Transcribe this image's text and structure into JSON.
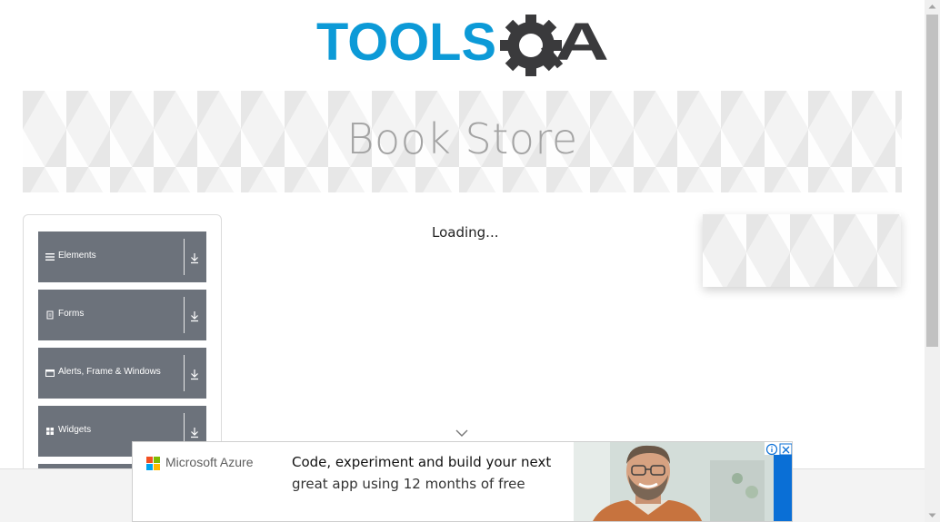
{
  "logo": {
    "text_left": "TOOLS",
    "text_right": "QA",
    "colors": {
      "tools": "#0c9ad7",
      "qa": "#3a3a3c"
    }
  },
  "banner": {
    "title": "Book Store"
  },
  "sidebar": {
    "items": [
      {
        "label": "Elements",
        "icon": "hamburger-icon"
      },
      {
        "label": "Forms",
        "icon": "document-icon"
      },
      {
        "label": "Alerts, Frame & Windows",
        "icon": "window-icon"
      },
      {
        "label": "Widgets",
        "icon": "grid-icon"
      }
    ]
  },
  "main": {
    "loading_text": "Loading..."
  },
  "ad": {
    "brand": "Microsoft Azure",
    "line1": "Code, experiment and build your next",
    "line2": "great app using 12 months of free",
    "colors": {
      "ms_red": "#f25022",
      "ms_green": "#7fba00",
      "ms_blue": "#00a4ef",
      "ms_yellow": "#ffb900",
      "azure_blue": "#0a6fd6"
    }
  },
  "colors": {
    "menu_bg": "#6c727b",
    "banner_title": "#a3a3a3"
  }
}
